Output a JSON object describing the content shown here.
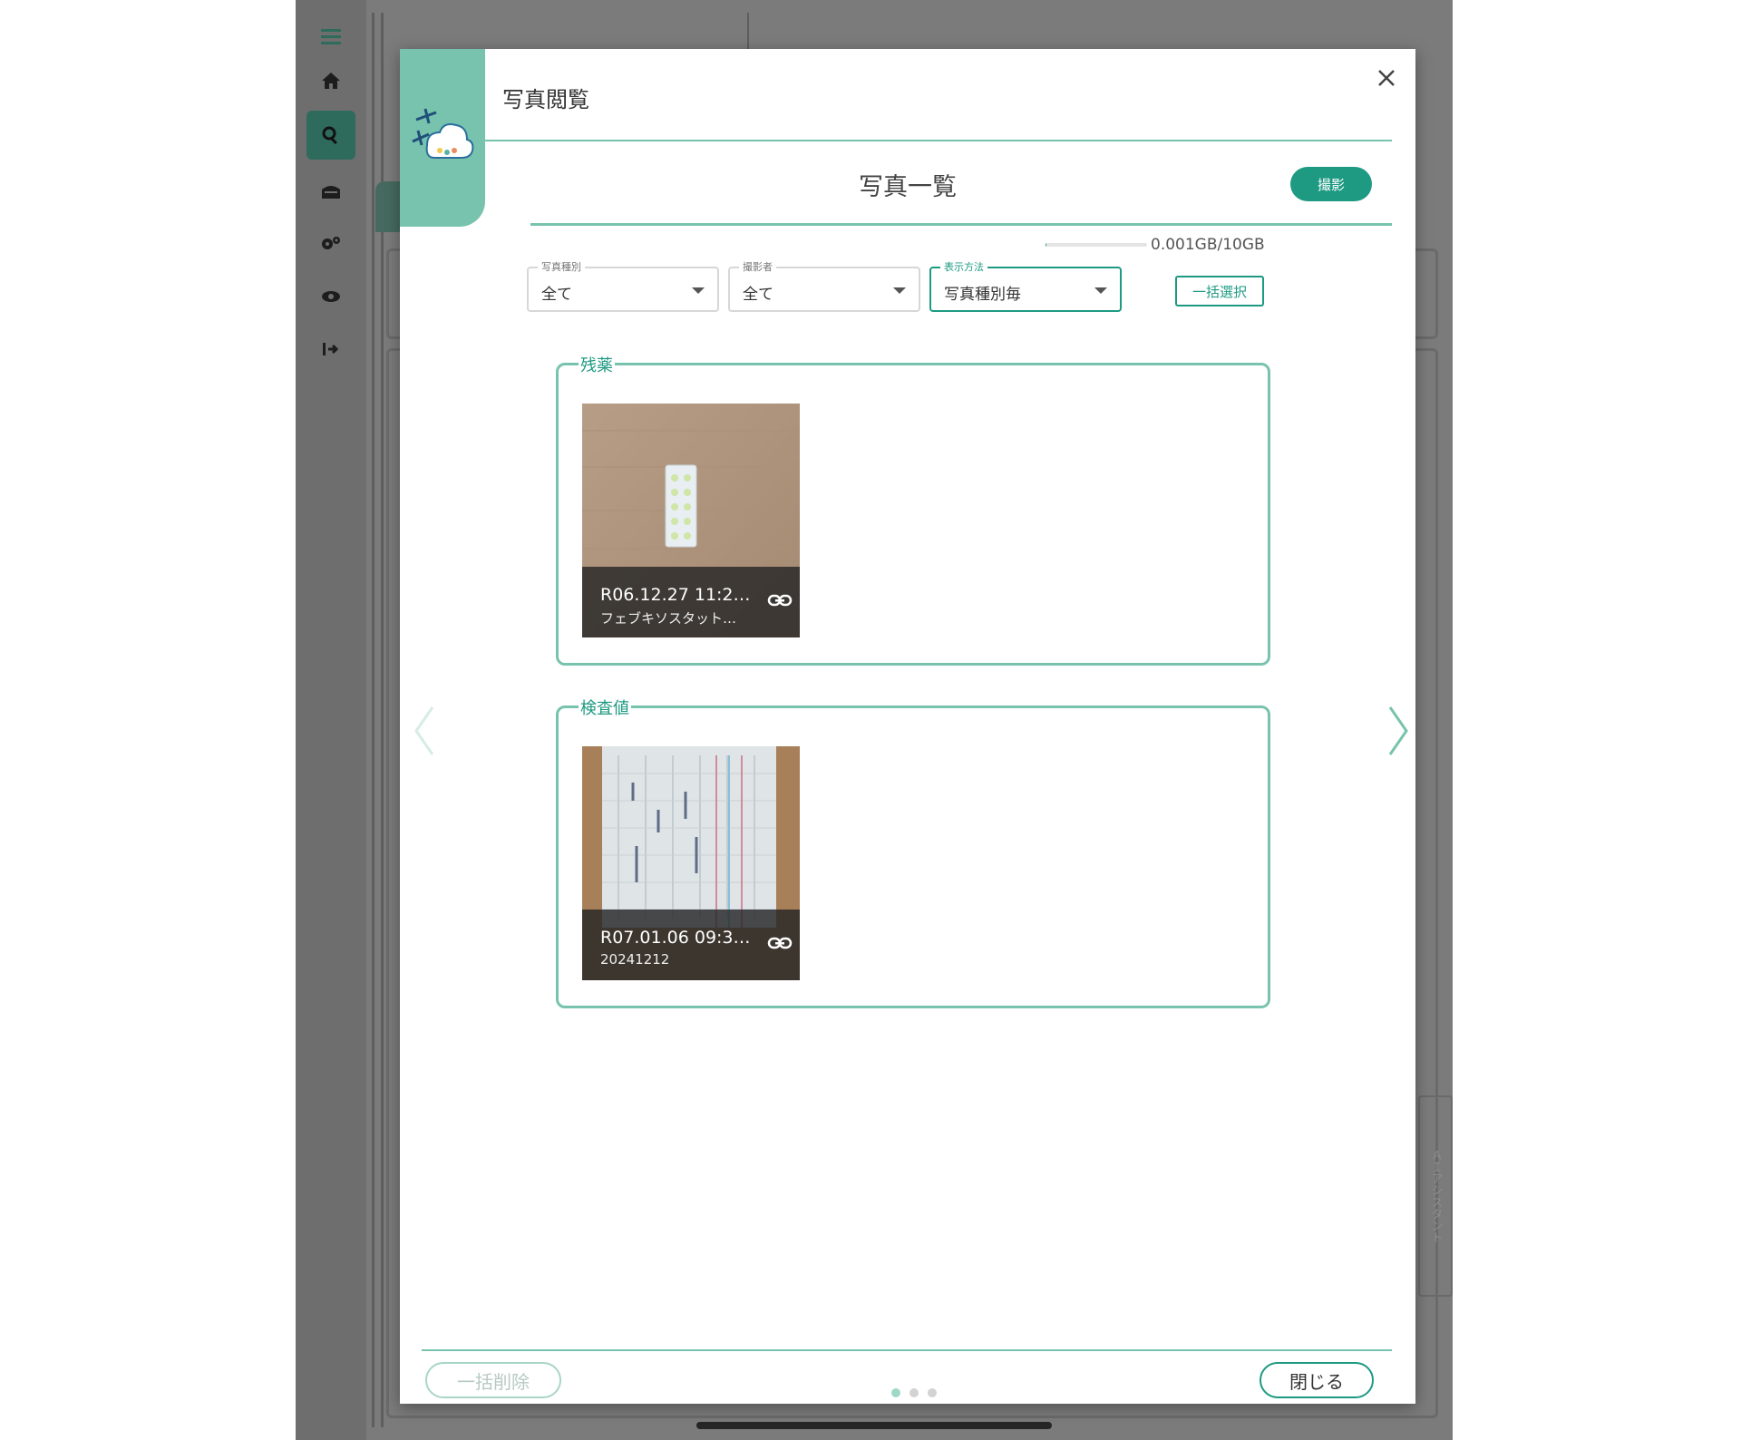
{
  "colors": {
    "accent": "#1e9a83",
    "accent_light": "#78c3ad",
    "overlay": "#7b7b7b"
  },
  "sidebar": {
    "items": [
      {
        "icon": "menu-icon",
        "active": false
      },
      {
        "icon": "home-icon",
        "active": false
      },
      {
        "icon": "search-icon",
        "active": true
      },
      {
        "icon": "building-icon",
        "active": false
      },
      {
        "icon": "gears-icon",
        "active": false
      },
      {
        "icon": "eye-icon",
        "active": false
      },
      {
        "icon": "logout-icon",
        "active": false
      }
    ]
  },
  "background": {
    "side_panel_label": "ＡＩアシスタント"
  },
  "modal": {
    "title": "写真閲覧",
    "close_icon": "close-icon",
    "list_title": "写真一覧",
    "shoot_button": "撮影",
    "storage": {
      "text": "0.001GB/10GB",
      "used_fraction": 0.0001
    },
    "filters": [
      {
        "label": "写真種別",
        "value": "全て"
      },
      {
        "label": "撮影者",
        "value": "全て"
      },
      {
        "label": "表示方法",
        "value": "写真種別毎"
      }
    ],
    "bulk_select_button": "一括選択",
    "groups": [
      {
        "legend": "残薬",
        "photos": [
          {
            "title": "R06.12.27 11:2…",
            "subtitle": "フェブキソスタット…",
            "link_icon": "link-icon"
          }
        ]
      },
      {
        "legend": "検査値",
        "photos": [
          {
            "title": "R07.01.06 09:3…",
            "subtitle": "20241212",
            "link_icon": "link-icon"
          }
        ]
      }
    ],
    "nav": {
      "prev_icon": "chevron-left-icon",
      "next_icon": "chevron-right-icon"
    },
    "footer": {
      "bulk_delete_button": "一括削除",
      "close_button": "閉じる",
      "pagination": {
        "pages": 3,
        "current": 1
      }
    }
  }
}
